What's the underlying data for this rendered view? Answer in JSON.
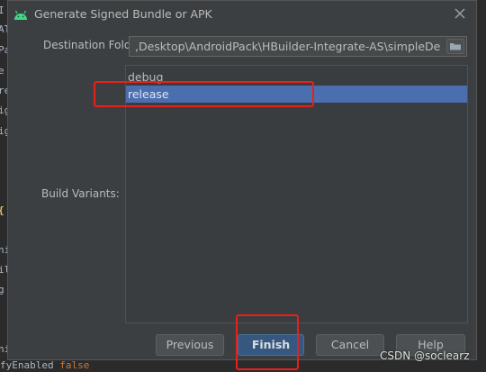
{
  "dialog": {
    "title": "Generate Signed Bundle or APK",
    "destination_label": "Destination Folder:",
    "destination_value": ",Desktop\\AndroidPack\\HBuilder-Integrate-AS\\simpleDemo",
    "build_variants_label": "Build Variants:",
    "variants": [
      "debug",
      "release"
    ],
    "selected_variant": "release",
    "buttons": {
      "previous": "Previous",
      "finish": "Finish",
      "cancel": "Cancel",
      "help": "Help"
    }
  },
  "background_code": {
    "fragments": [
      "I",
      "AT",
      "Pa",
      "e",
      "re",
      "ig",
      "ig",
      "{",
      "ni",
      "ili",
      "g",
      "ni"
    ],
    "bottom_line_text": "fyEnabled",
    "bottom_line_keyword": "false"
  },
  "watermark": "CSDN @soclearz",
  "colors": {
    "dialog_bg": "#3c3f41",
    "selection": "#4b6eaf",
    "primary_button": "#365880",
    "highlight": "#e8201c",
    "android_icon": "#3ddc84"
  },
  "icons": {
    "title": "android-icon",
    "close": "close-icon",
    "browse": "folder-icon"
  }
}
